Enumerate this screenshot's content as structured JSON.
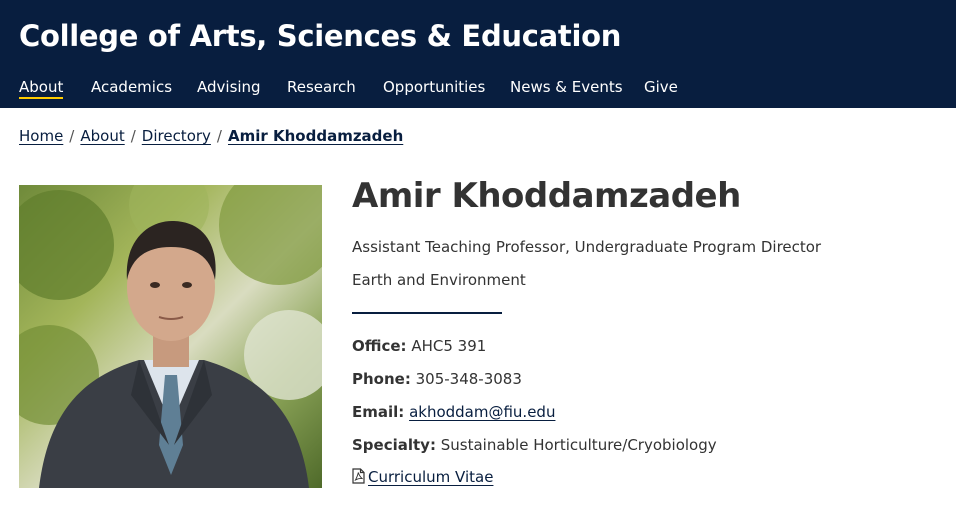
{
  "header": {
    "site_title": "College of Arts, Sciences & Education",
    "background_color": "#081e3f",
    "active_underline_color": "#ffcc00"
  },
  "nav": {
    "items": [
      {
        "label": "About",
        "active": true
      },
      {
        "label": "Academics",
        "active": false
      },
      {
        "label": "Advising",
        "active": false
      },
      {
        "label": "Research",
        "active": false
      },
      {
        "label": "Opportunities",
        "active": false
      },
      {
        "label": "News & Events",
        "active": false
      },
      {
        "label": "Give",
        "active": false
      }
    ]
  },
  "breadcrumb": {
    "items": [
      "Home",
      "About",
      "Directory"
    ],
    "current": "Amir Khoddamzadeh",
    "separator": "/"
  },
  "profile": {
    "photo_icon": "portrait-photo",
    "name": "Amir Khoddamzadeh",
    "title": "Assistant Teaching Professor, Undergraduate Program Director",
    "department": "Earth and Environment",
    "office_label": "Office:",
    "office_value": "AHC5 391",
    "phone_label": "Phone:",
    "phone_value": "305-348-3083",
    "email_label": "Email:",
    "email_value": "akhoddam@fiu.edu",
    "specialty_label": "Specialty:",
    "specialty_value": "Sustainable Horticulture/Cryobiology",
    "cv_icon": "pdf-file-icon",
    "cv_label": "Curriculum Vitae"
  }
}
